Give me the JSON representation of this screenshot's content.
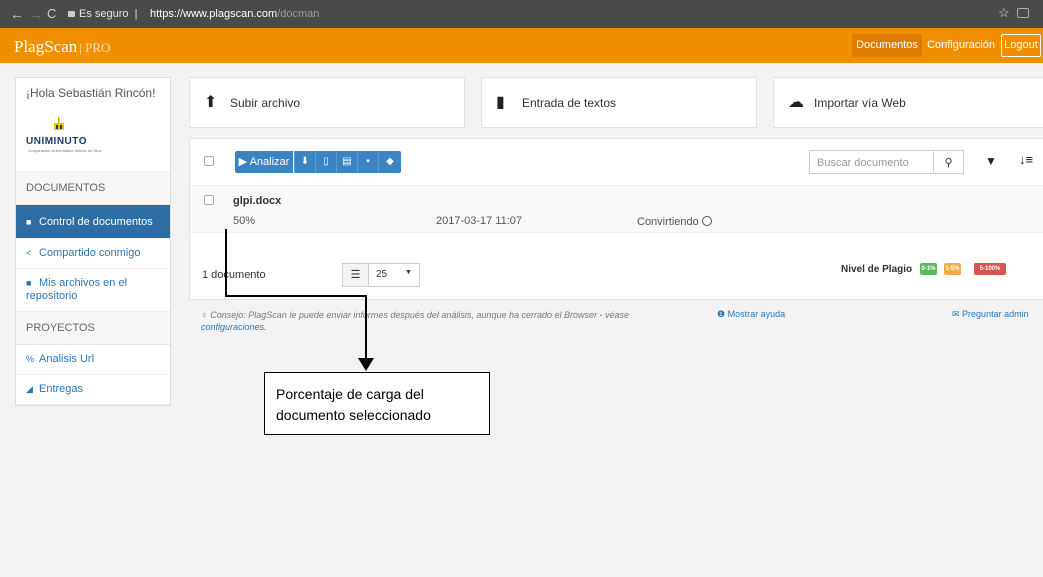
{
  "browser": {
    "secure_label": "Es seguro",
    "url_host": "https://www.plagscan.com",
    "url_path": "/docman"
  },
  "app": {
    "logo": "PlagScan",
    "logo_suffix": "| PRO",
    "nav": {
      "documentos": "Documentos",
      "configuracion": "Configuración",
      "logout": "Logout"
    },
    "accent_color": "#f09000"
  },
  "sidebar": {
    "greeting": "¡Hola Sebastián Rincón!",
    "org_logo_text": "UNIMINUTO",
    "org_logo_sub": "Corporación Universitaria Minuto de Dios",
    "sections": [
      {
        "title": "DOCUMENTOS"
      },
      {
        "title": "PROYECTOS"
      }
    ],
    "items": [
      {
        "label": "Control de documentos",
        "icon": "file-icon",
        "active": true
      },
      {
        "label": "Compartido conmigo",
        "icon": "share-icon"
      },
      {
        "label": "Mis archivos en el repositorio",
        "icon": "archive-icon"
      },
      {
        "label": "Analisis Url",
        "icon": "link-icon"
      },
      {
        "label": "Entregas",
        "icon": "send-icon"
      }
    ]
  },
  "actions": {
    "upload": "Subir archivo",
    "text_entry": "Entrada de textos",
    "import_web": "Importar vía Web"
  },
  "toolbar": {
    "analyze": "Analizar",
    "search_placeholder": "Buscar documento"
  },
  "documents": [
    {
      "name": "glpi.docx",
      "progress": "50%",
      "date": "2017-03-17 11:07",
      "status": "Convirtiendo"
    }
  ],
  "footer": {
    "count": "1 documento",
    "page_size": "25",
    "nivel_label": "Nivel de Plagio",
    "badges": [
      {
        "label": "0-1%",
        "color": "#5cb85c"
      },
      {
        "label": "1-5%",
        "color": "#f0ad4e"
      },
      {
        "label": "5-100%",
        "color": "#d9534f"
      }
    ]
  },
  "tip": {
    "text": "Consejo: PlagScan le puede enviar informes después del análisis, aunque ha cerrado el Browser - véase",
    "link": "configuraciones."
  },
  "help": {
    "show_help": "Mostrar ayuda",
    "ask_admin": "Preguntar admin"
  },
  "annotation": {
    "line1": "Porcentaje de carga del",
    "line2": "documento seleccionado"
  }
}
